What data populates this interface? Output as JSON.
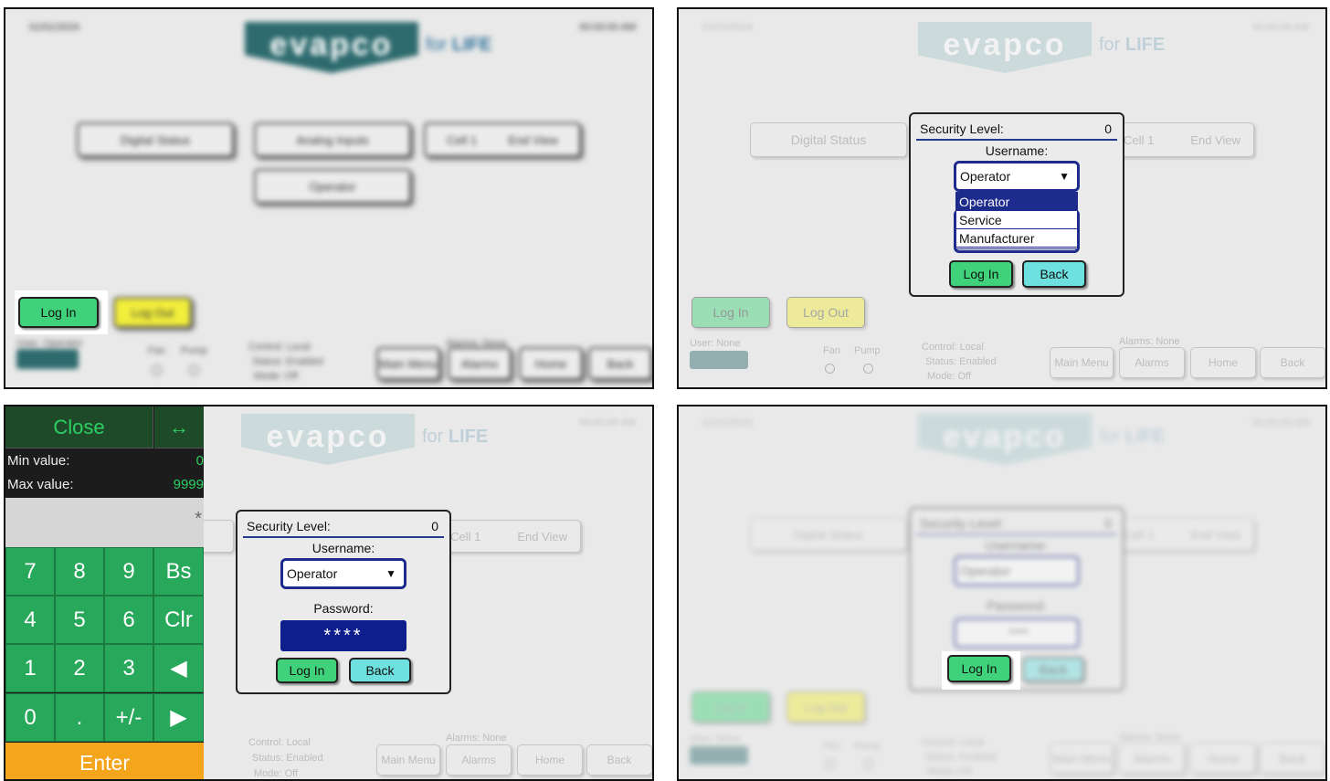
{
  "panel1": {
    "top_left": "01/01/2024",
    "top_right": "00:00:00 AM",
    "buttons": [
      "Digital Status",
      "Analog Inputs",
      "Cell 1",
      "End View",
      "Operator"
    ],
    "login": "Log In",
    "logout": "Log Out",
    "user": "User: Operator",
    "fan": "Fan",
    "pump": "Pump",
    "control": "Control: Local",
    "status": "Status: Enabled",
    "mode": "Mode: Off",
    "alarms": "Alarms: None",
    "nav": [
      "Main Menu",
      "Alarms",
      "Home",
      "Back"
    ]
  },
  "logo": {
    "word": "evapco",
    "tag_prefix": "for ",
    "tag_strong": "LIFE",
    "small_word": "evapco",
    "small_tag": "for LIFE"
  },
  "panel2": {
    "top_left": "01/01/2024",
    "top_right": "00:00:00 AM",
    "buttons": [
      "Digital Status",
      "Cell 1",
      "End View"
    ],
    "dialog": {
      "security_label": "Security Level:",
      "security_value": "0",
      "username_label": "Username:",
      "selected": "Operator",
      "arrow": "▼",
      "options": [
        "Operator",
        "Service",
        "Manufacturer"
      ],
      "login": "Log In",
      "back": "Back"
    },
    "login": "Log In",
    "logout": "Log Out",
    "user": "User: None",
    "fan": "Fan",
    "pump": "Pump",
    "control": "Control: Local",
    "status": "Status: Enabled",
    "mode": "Mode: Off",
    "alarms": "Alarms: None",
    "nav": [
      "Main Menu",
      "Alarms",
      "Home",
      "Back"
    ]
  },
  "panel3": {
    "keypad": {
      "close": "Close",
      "move": "↔",
      "min_label": "Min value:",
      "min_value": "0",
      "max_label": "Max value:",
      "max_value": "9999",
      "display_mark": "*",
      "keys": [
        "7",
        "8",
        "9",
        "Bs",
        "4",
        "5",
        "6",
        "Clr",
        "1",
        "2",
        "3",
        "◀",
        "0",
        ".",
        "+/-",
        "▶"
      ],
      "enter": "Enter"
    },
    "top_right": "00:00:00 AM",
    "buttons": [
      "Cell 1",
      "End View"
    ],
    "dialog": {
      "security_label": "Security Level:",
      "security_value": "0",
      "username_label": "Username:",
      "selected": "Operator",
      "arrow": "▼",
      "password_label": "Password:",
      "password_value": "****",
      "login": "Log In",
      "back": "Back"
    },
    "control": "Control: Local",
    "status": "Status: Enabled",
    "mode": "Mode: Off",
    "alarms": "Alarms: None",
    "nav": [
      "Main Menu",
      "Alarms",
      "Home",
      "Back"
    ]
  },
  "panel4": {
    "top_left": "01/01/2024",
    "top_right": "00:00:00 AM",
    "buttons": [
      "Digital Status",
      "Cell 1",
      "End View"
    ],
    "dialog": {
      "security_label": "Security Level:",
      "security_value": "0",
      "username_label": "Username:",
      "selected": "Operator",
      "password_label": "Password:",
      "password_value": "****",
      "login": "Log In",
      "back": "Back"
    },
    "login": "Log In",
    "logout": "Log Out",
    "user": "User: None",
    "fan": "Fan",
    "pump": "Pump",
    "control": "Control: Local",
    "status": "Status: Enabled",
    "mode": "Mode: Off",
    "alarms": "Alarms: None",
    "nav": [
      "Main Menu",
      "Alarms",
      "Home",
      "Back"
    ]
  },
  "colors": {
    "green": "#3fd27a",
    "cyan": "#6fe0e0",
    "yellow": "#f2ee3c",
    "navy": "#1c2b8c",
    "keypad_green": "#28a85a",
    "enter_orange": "#f4a51c",
    "logo_teal": "#2e6b6e"
  }
}
